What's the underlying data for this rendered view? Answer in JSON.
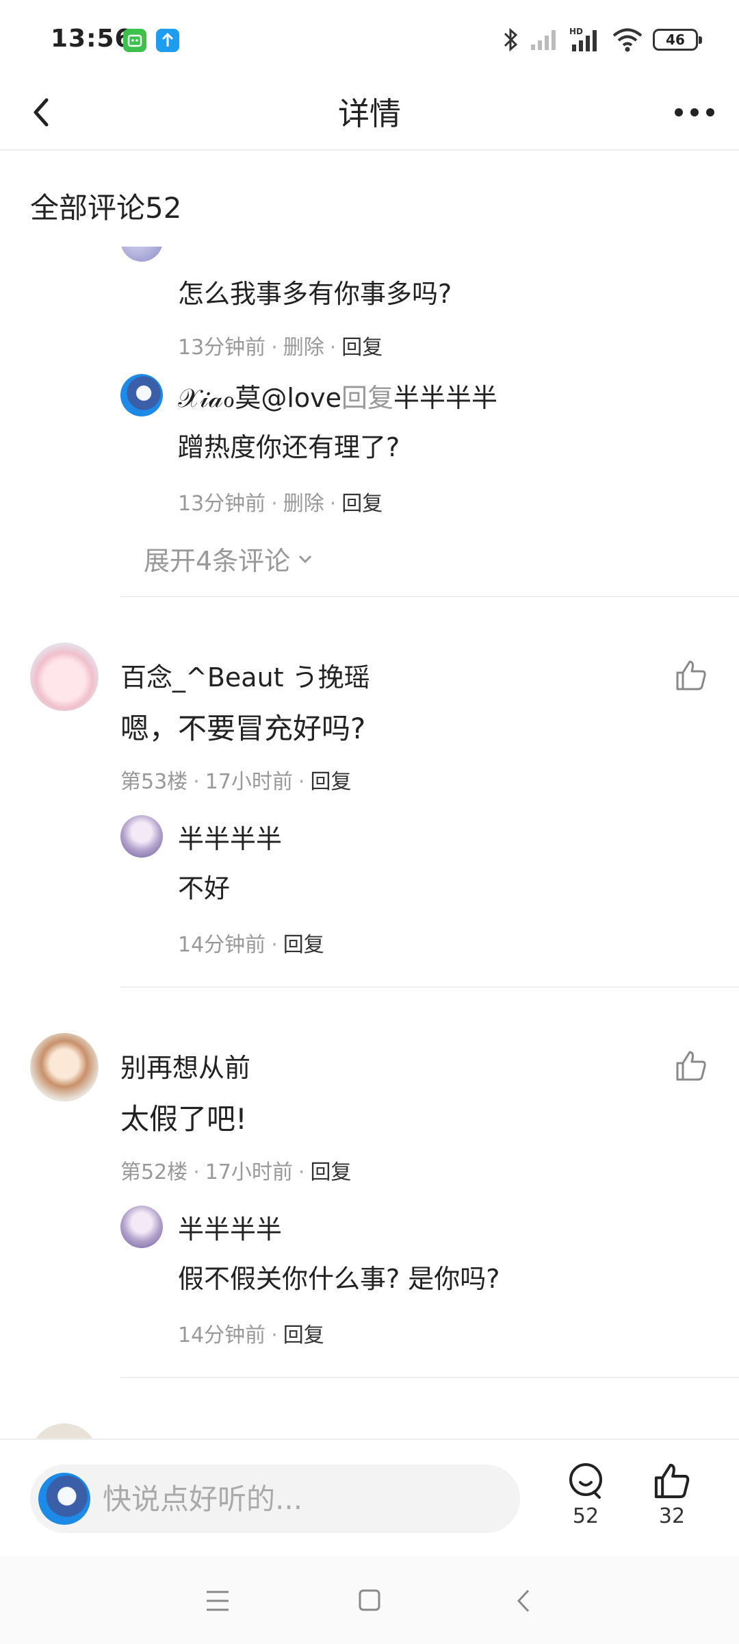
{
  "status_bar": {
    "time": "13:56",
    "battery": "46"
  },
  "header": {
    "title": "详情"
  },
  "section": {
    "title": "全部评论52"
  },
  "threads": [
    {
      "replies": [
        {
          "text": "怎么我事多有你事多吗?",
          "time": "13分钟前",
          "delete": "删除",
          "reply": "回复"
        },
        {
          "user": "𝒳𝒾𝒶ℴ莫@love",
          "reply_word": "回复",
          "target": "半半半半",
          "text": "蹭热度你还有理了?",
          "time": "13分钟前",
          "delete": "删除",
          "reply": "回复"
        }
      ],
      "expand": "展开4条评论"
    },
    {
      "user": "百念_^Beaut う挽瑶",
      "text": "嗯，不要冒充好吗?",
      "floor": "第53楼",
      "time": "17小时前",
      "reply": "回复",
      "replies": [
        {
          "user": "半半半半",
          "text": "不好",
          "time": "14分钟前",
          "reply": "回复"
        }
      ]
    },
    {
      "user": "别再想从前",
      "text": "太假了吧!",
      "floor": "第52楼",
      "time": "17小时前",
      "reply": "回复",
      "replies": [
        {
          "user": "半半半半",
          "text": "假不假关你什么事? 是你吗?",
          "time": "14分钟前",
          "reply": "回复"
        }
      ]
    }
  ],
  "bottom_bar": {
    "placeholder": "快说点好听的...",
    "comment_count": "52",
    "like_count": "32"
  },
  "colors": {
    "text": "#222222",
    "meta": "#999999",
    "divider": "#f0f0f0",
    "input_bg": "#f3f3f3"
  },
  "icons": [
    "back-arrow-icon",
    "more-dots-icon",
    "thumbs-up-icon",
    "comment-bubble-icon",
    "chevron-down-icon",
    "menu-icon",
    "home-square-icon",
    "back-chevron-icon",
    "bluetooth-icon",
    "signal-icon",
    "wifi-icon",
    "battery-icon"
  ]
}
